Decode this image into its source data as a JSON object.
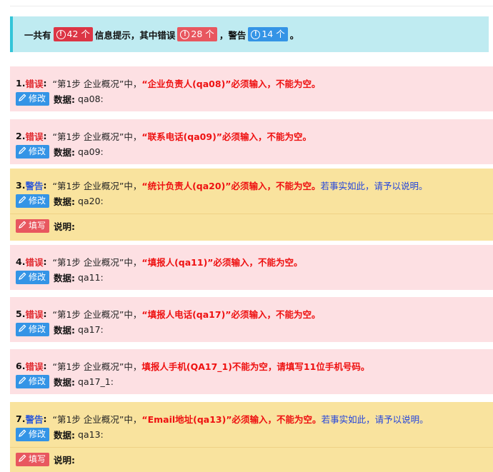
{
  "summary": {
    "prefix": "一共有",
    "total": "42 个",
    "middle": "信息提示，其中错误",
    "errors": "28 个",
    "sep": "，警告",
    "warnings": "14 个",
    "suffix": "。"
  },
  "colors": {
    "error_bg": "#fde0e3",
    "warning_bg": "#f9e39e",
    "info_bg": "#bfebf1",
    "edit_btn": "#3494e6",
    "fill_btn": "#e8575f"
  },
  "edit_label": "修改",
  "fill_label": "填写",
  "data_label": "数据:",
  "note_label": "说明:",
  "items": [
    {
      "num": "1.",
      "level": "错误",
      "colon": ":",
      "step": "“第1步 企业概况”中，",
      "field": "“企业负责人(qa08)”必须输入，不能为空。",
      "hint": "",
      "data": "qa08:"
    },
    {
      "num": "2.",
      "level": "错误",
      "colon": ":",
      "step": "“第1步 企业概况”中，",
      "field": "“联系电话(qa09)”必须输入，不能为空。",
      "hint": "",
      "data": "qa09:"
    },
    {
      "num": "3.",
      "level": "警告",
      "colon": ":",
      "step": "“第1步 企业概况”中，",
      "field": "“统计负责人(qa20)”必须输入，不能为空。",
      "hint": "若事实如此，请予以说明。",
      "data": "qa20:"
    },
    {
      "num": "4.",
      "level": "错误",
      "colon": ":",
      "step": "“第1步 企业概况”中，",
      "field": "“填报人(qa11)”必须输入，不能为空。",
      "hint": "",
      "data": "qa11:"
    },
    {
      "num": "5.",
      "level": "错误",
      "colon": ":",
      "step": "“第1步 企业概况”中，",
      "field": "“填报人电话(qa17)”必须输入，不能为空。",
      "hint": "",
      "data": "qa17:"
    },
    {
      "num": "6.",
      "level": "错误",
      "colon": ":",
      "step": "“第1步 企业概况”中，",
      "field": "填报人手机(QA17_1)不能为空，请填写11位手机号码。",
      "hint": "",
      "data": "qa17_1:"
    },
    {
      "num": "7.",
      "level": "警告",
      "colon": ":",
      "step": "“第1步 企业概况”中，",
      "field": "“Email地址(qa13)”必须输入，不能为空。",
      "hint": "若事实如此，请予以说明。",
      "data": "qa13:"
    }
  ]
}
